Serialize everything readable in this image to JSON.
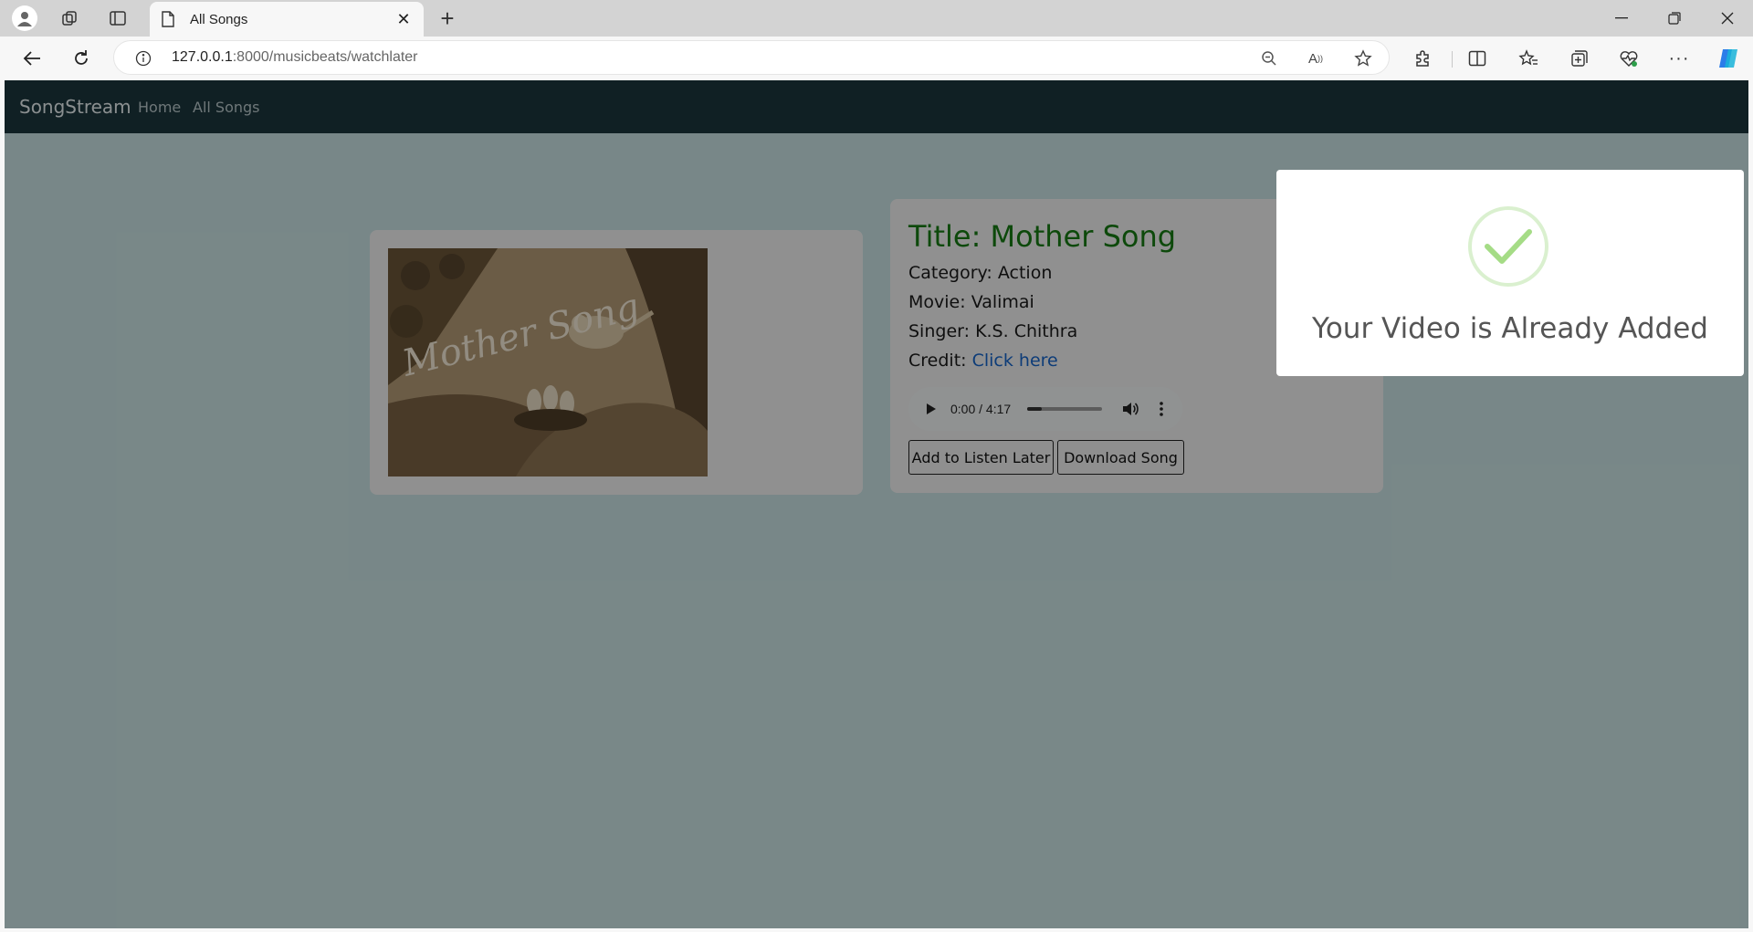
{
  "browser": {
    "tab_title": "All Songs",
    "url_host": "127.0.0.1",
    "url_rest": ":8000/musicbeats/watchlater"
  },
  "site": {
    "brand": "SongStream",
    "nav_links": [
      "Home",
      "All Songs"
    ]
  },
  "song": {
    "thumbnail_text": "Mother Song",
    "title": "Title: Mother Song",
    "category_label": "Category:",
    "category": "Action",
    "movie_label": "Movie:",
    "movie": "Valimai",
    "singer_label": "Singer:",
    "singer": "K.S. Chithra",
    "credit_label": "Credit:",
    "credit_link": "Click here"
  },
  "player": {
    "time": "0:00 / 4:17",
    "progress": 0.0
  },
  "buttons": {
    "listen_later": "Add to Listen Later",
    "download": "Download Song"
  },
  "modal": {
    "icon": "checkmark-icon",
    "message": "Your Video is Already Added",
    "accent": "#a5dc86"
  }
}
